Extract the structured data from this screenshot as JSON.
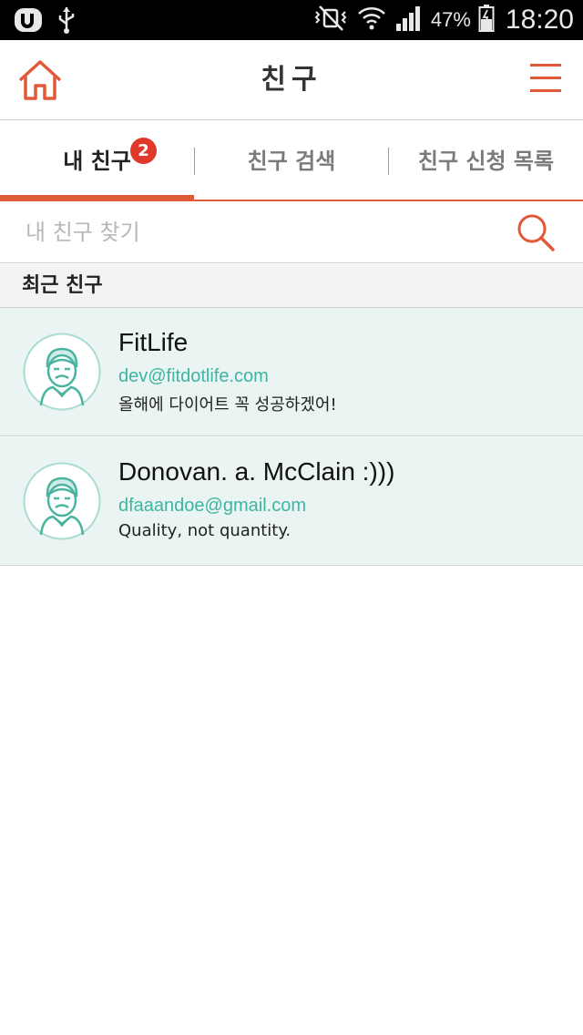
{
  "status_bar": {
    "battery": "47%",
    "time": "18:20",
    "icons": [
      "carrier-logo-icon",
      "usb-icon",
      "vibrate-mute-icon",
      "wifi-icon",
      "signal-icon",
      "battery-icon"
    ]
  },
  "header": {
    "title": "친구",
    "home_icon": "home-icon",
    "menu_icon": "hamburger-menu-icon"
  },
  "tabs": [
    {
      "label": "내 친구",
      "badge": "2",
      "active": true
    },
    {
      "label": "친구 검색",
      "active": false
    },
    {
      "label": "친구 신청 목록",
      "active": false
    }
  ],
  "search": {
    "placeholder": "내 친구 찾기",
    "value": "",
    "icon": "search-icon"
  },
  "section": {
    "label": "최근 친구"
  },
  "friends": [
    {
      "name": "FitLife",
      "email": "dev@fitdotlife.com",
      "status": "올해에 다이어트 꼭 성공하겠어!"
    },
    {
      "name": "Donovan. a. McClain :)))",
      "email": "dfaaandoe@gmail.com",
      "status": "Quality, not quantity."
    }
  ],
  "colors": {
    "accent": "#e05a3a",
    "badge": "#e0392b",
    "email": "#3fb59f",
    "list_bg": "#e9f4f3"
  }
}
